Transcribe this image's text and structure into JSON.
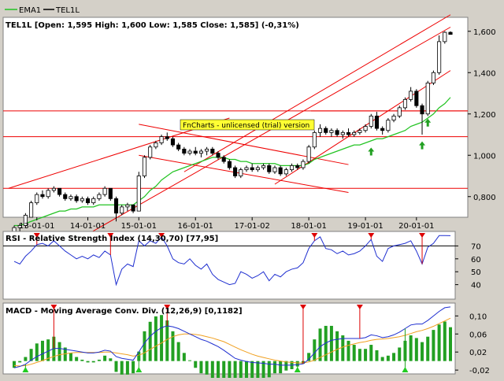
{
  "legend": [
    {
      "name": "EMA1",
      "color": "#22c322"
    },
    {
      "name": "TEL1L",
      "color": "#000000"
    }
  ],
  "price_panel": {
    "title": "TEL1L [Open: 1,595  High: 1,600  Low: 1,585  Close: 1,585] (-0,31%)",
    "y_ticks": [
      "1,600",
      "1,400",
      "1,200",
      "1,000",
      "0,800"
    ],
    "x_ticks": [
      "13-01-01",
      "14-01-01",
      "15-01-01",
      "16-01-01",
      "17-01-02",
      "18-01-01",
      "19-01-01",
      "20-01-01"
    ],
    "watermark": "FnCharts - unlicensed (trial) version"
  },
  "rsi_panel": {
    "title": "RSI - Relative Strength Index (14,30,70) [77,95]",
    "y_ticks": [
      "70",
      "60",
      "50",
      "40"
    ]
  },
  "macd_panel": {
    "title": "MACD - Moving Average Conv. Div. (12,26,9) [0,1182]",
    "y_ticks": [
      "0,10",
      "0,06",
      "0,02",
      "-0,02"
    ]
  },
  "colors": {
    "up_candle": "#ffffff",
    "down_candle": "#000000",
    "ema": "#22c322",
    "trendline": "#ee0000",
    "rsi": "#1f2fd0",
    "macd": "#1f2fd0",
    "signal": "#f0a020",
    "histogram": "#22a022",
    "signal_arrow": "#22a022",
    "marker": "#dd0000"
  },
  "chart_data": [
    {
      "type": "candlestick",
      "series_name": "TEL1L",
      "ylim": [
        0.7,
        1.66
      ],
      "x_start": "2012-06-01",
      "interval": "weekly",
      "ohlc": [
        [
          0.63,
          0.66,
          0.61,
          0.65
        ],
        [
          0.65,
          0.67,
          0.63,
          0.66
        ],
        [
          0.66,
          0.72,
          0.65,
          0.71
        ],
        [
          0.7,
          0.78,
          0.7,
          0.77
        ],
        [
          0.77,
          0.82,
          0.76,
          0.81
        ],
        [
          0.81,
          0.83,
          0.79,
          0.8
        ],
        [
          0.8,
          0.84,
          0.79,
          0.83
        ],
        [
          0.83,
          0.85,
          0.82,
          0.84
        ],
        [
          0.84,
          0.84,
          0.8,
          0.81
        ],
        [
          0.81,
          0.82,
          0.78,
          0.79
        ],
        [
          0.79,
          0.81,
          0.78,
          0.8
        ],
        [
          0.8,
          0.81,
          0.77,
          0.78
        ],
        [
          0.78,
          0.8,
          0.77,
          0.79
        ],
        [
          0.79,
          0.8,
          0.76,
          0.77
        ],
        [
          0.77,
          0.8,
          0.76,
          0.79
        ],
        [
          0.79,
          0.82,
          0.78,
          0.81
        ],
        [
          0.81,
          0.85,
          0.8,
          0.84
        ],
        [
          0.84,
          0.84,
          0.78,
          0.79
        ],
        [
          0.79,
          0.8,
          0.68,
          0.72
        ],
        [
          0.72,
          0.76,
          0.71,
          0.75
        ],
        [
          0.75,
          0.77,
          0.73,
          0.76
        ],
        [
          0.76,
          0.75,
          0.72,
          0.73
        ],
        [
          0.73,
          0.92,
          0.73,
          0.9
        ],
        [
          0.9,
          1.0,
          0.89,
          0.99
        ],
        [
          0.99,
          1.05,
          0.98,
          1.04
        ],
        [
          1.04,
          1.07,
          1.03,
          1.06
        ],
        [
          1.06,
          1.1,
          1.05,
          1.09
        ],
        [
          1.09,
          1.11,
          1.07,
          1.08
        ],
        [
          1.08,
          1.09,
          1.04,
          1.05
        ],
        [
          1.05,
          1.06,
          1.02,
          1.03
        ],
        [
          1.03,
          1.04,
          1.0,
          1.01
        ],
        [
          1.01,
          1.03,
          1.0,
          1.02
        ],
        [
          1.02,
          1.04,
          1.0,
          1.01
        ],
        [
          1.01,
          1.03,
          0.99,
          1.02
        ],
        [
          1.02,
          1.04,
          1.0,
          1.03
        ],
        [
          1.03,
          1.04,
          1.0,
          1.01
        ],
        [
          1.01,
          1.02,
          0.98,
          0.99
        ],
        [
          0.99,
          1.0,
          0.96,
          0.97
        ],
        [
          0.97,
          0.98,
          0.93,
          0.94
        ],
        [
          0.94,
          0.95,
          0.89,
          0.9
        ],
        [
          0.9,
          0.94,
          0.89,
          0.93
        ],
        [
          0.93,
          0.95,
          0.92,
          0.94
        ],
        [
          0.94,
          0.96,
          0.92,
          0.93
        ],
        [
          0.93,
          0.95,
          0.92,
          0.94
        ],
        [
          0.94,
          0.96,
          0.93,
          0.95
        ],
        [
          0.95,
          0.96,
          0.91,
          0.92
        ],
        [
          0.92,
          0.95,
          0.91,
          0.94
        ],
        [
          0.94,
          0.95,
          0.9,
          0.91
        ],
        [
          0.91,
          0.94,
          0.9,
          0.93
        ],
        [
          0.93,
          0.96,
          0.92,
          0.95
        ],
        [
          0.95,
          0.96,
          0.93,
          0.94
        ],
        [
          0.94,
          0.98,
          0.93,
          0.97
        ],
        [
          0.97,
          1.05,
          0.96,
          1.04
        ],
        [
          1.04,
          1.12,
          1.03,
          1.11
        ],
        [
          1.11,
          1.15,
          1.09,
          1.13
        ],
        [
          1.13,
          1.14,
          1.1,
          1.11
        ],
        [
          1.11,
          1.13,
          1.09,
          1.12
        ],
        [
          1.12,
          1.13,
          1.09,
          1.1
        ],
        [
          1.1,
          1.12,
          1.08,
          1.11
        ],
        [
          1.11,
          1.13,
          1.09,
          1.1
        ],
        [
          1.1,
          1.12,
          1.09,
          1.11
        ],
        [
          1.11,
          1.13,
          1.1,
          1.12
        ],
        [
          1.12,
          1.15,
          1.11,
          1.14
        ],
        [
          1.14,
          1.2,
          1.13,
          1.19
        ],
        [
          1.19,
          1.21,
          1.12,
          1.13
        ],
        [
          1.13,
          1.14,
          1.1,
          1.12
        ],
        [
          1.12,
          1.18,
          1.11,
          1.17
        ],
        [
          1.17,
          1.2,
          1.16,
          1.19
        ],
        [
          1.19,
          1.24,
          1.18,
          1.23
        ],
        [
          1.23,
          1.28,
          1.22,
          1.27
        ],
        [
          1.27,
          1.33,
          1.26,
          1.31
        ],
        [
          1.31,
          1.32,
          1.23,
          1.24
        ],
        [
          1.24,
          1.25,
          1.1,
          1.2
        ],
        [
          1.2,
          1.36,
          1.19,
          1.35
        ],
        [
          1.35,
          1.41,
          1.34,
          1.4
        ],
        [
          1.4,
          1.58,
          1.39,
          1.55
        ],
        [
          1.55,
          1.6,
          1.54,
          1.595
        ],
        [
          1.595,
          1.6,
          1.585,
          1.585
        ]
      ]
    },
    {
      "type": "line",
      "name": "EMA1",
      "values": [
        0.66,
        0.66,
        0.67,
        0.68,
        0.69,
        0.7,
        0.71,
        0.72,
        0.73,
        0.73,
        0.74,
        0.74,
        0.75,
        0.75,
        0.75,
        0.76,
        0.76,
        0.76,
        0.76,
        0.76,
        0.76,
        0.76,
        0.78,
        0.8,
        0.83,
        0.85,
        0.88,
        0.9,
        0.92,
        0.93,
        0.94,
        0.95,
        0.96,
        0.97,
        0.98,
        0.99,
        0.99,
        0.99,
        0.98,
        0.98,
        0.97,
        0.97,
        0.96,
        0.96,
        0.96,
        0.96,
        0.96,
        0.95,
        0.95,
        0.95,
        0.95,
        0.95,
        0.96,
        0.98,
        0.99,
        1.0,
        1.01,
        1.02,
        1.03,
        1.04,
        1.05,
        1.05,
        1.06,
        1.07,
        1.08,
        1.08,
        1.09,
        1.1,
        1.11,
        1.12,
        1.14,
        1.15,
        1.16,
        1.18,
        1.2,
        1.23,
        1.25,
        1.28
      ]
    },
    {
      "type": "line",
      "name": "RSI",
      "ylim": [
        30,
        80
      ],
      "values": [
        58,
        56,
        62,
        66,
        71,
        72,
        70,
        74,
        70,
        66,
        63,
        60,
        62,
        60,
        63,
        61,
        66,
        63,
        40,
        52,
        56,
        54,
        74,
        70,
        74,
        72,
        77,
        70,
        60,
        57,
        56,
        60,
        55,
        52,
        56,
        48,
        44,
        42,
        40,
        41,
        50,
        48,
        45,
        47,
        50,
        43,
        48,
        46,
        50,
        52,
        53,
        57,
        68,
        74,
        77,
        68,
        67,
        64,
        66,
        63,
        64,
        66,
        70,
        75,
        62,
        58,
        68,
        70,
        71,
        72,
        74,
        66,
        56,
        69,
        72,
        78,
        78,
        77.95
      ],
      "reference_lines": [
        70,
        30
      ]
    },
    {
      "type": "line",
      "name": "MACD",
      "ylim": [
        -0.025,
        0.125
      ],
      "macd": [
        -0.015,
        -0.012,
        -0.007,
        0.002,
        0.01,
        0.016,
        0.022,
        0.028,
        0.028,
        0.026,
        0.024,
        0.022,
        0.02,
        0.018,
        0.018,
        0.02,
        0.024,
        0.022,
        0.01,
        0.006,
        0.004,
        0.002,
        0.02,
        0.04,
        0.055,
        0.066,
        0.074,
        0.078,
        0.076,
        0.072,
        0.066,
        0.06,
        0.054,
        0.048,
        0.044,
        0.038,
        0.032,
        0.024,
        0.015,
        0.006,
        0.002,
        -0.001,
        -0.003,
        -0.004,
        -0.005,
        -0.007,
        -0.007,
        -0.009,
        -0.009,
        -0.009,
        -0.008,
        -0.006,
        0.004,
        0.018,
        0.032,
        0.04,
        0.046,
        0.048,
        0.05,
        0.05,
        0.05,
        0.05,
        0.052,
        0.058,
        0.056,
        0.052,
        0.054,
        0.058,
        0.064,
        0.072,
        0.08,
        0.082,
        0.082,
        0.09,
        0.1,
        0.11,
        0.1182,
        0.12
      ],
      "signal": [
        -0.01,
        -0.011,
        -0.01,
        -0.007,
        -0.003,
        0.001,
        0.006,
        0.01,
        0.014,
        0.016,
        0.018,
        0.019,
        0.019,
        0.019,
        0.019,
        0.019,
        0.02,
        0.02,
        0.018,
        0.016,
        0.014,
        0.011,
        0.013,
        0.018,
        0.026,
        0.033,
        0.04,
        0.048,
        0.054,
        0.058,
        0.06,
        0.06,
        0.059,
        0.057,
        0.054,
        0.051,
        0.047,
        0.043,
        0.037,
        0.031,
        0.025,
        0.02,
        0.015,
        0.011,
        0.008,
        0.005,
        0.002,
        0.0,
        -0.002,
        -0.003,
        -0.004,
        -0.004,
        -0.002,
        0.002,
        0.008,
        0.014,
        0.02,
        0.026,
        0.031,
        0.035,
        0.038,
        0.041,
        0.043,
        0.046,
        0.048,
        0.049,
        0.05,
        0.052,
        0.054,
        0.057,
        0.061,
        0.065,
        0.068,
        0.072,
        0.077,
        0.083,
        0.089,
        0.095
      ]
    }
  ]
}
